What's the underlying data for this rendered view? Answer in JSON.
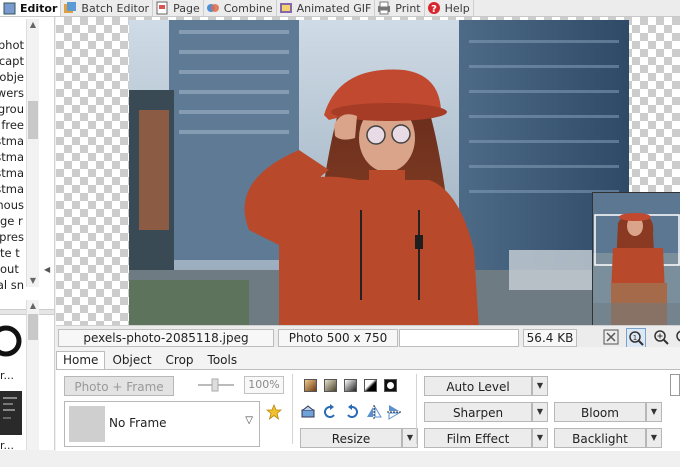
{
  "tabs": [
    {
      "label": "Editor",
      "icon": "editor-icon",
      "active": true
    },
    {
      "label": "Batch Editor",
      "icon": "batch-editor-icon"
    },
    {
      "label": "Page",
      "icon": "page-icon"
    },
    {
      "label": "Combine",
      "icon": "combine-icon"
    },
    {
      "label": "Animated GIF",
      "icon": "animated-gif-icon"
    },
    {
      "label": "Print",
      "icon": "print-icon"
    },
    {
      "label": "Help",
      "icon": "help-icon"
    }
  ],
  "file_list": [
    "phot",
    "capt",
    "obje",
    "wers",
    "kgrou",
    "t free",
    "stma",
    "stma",
    "stma",
    "stma",
    "hous",
    "ge r",
    "pres",
    "te t",
    "out",
    "tal sn"
  ],
  "thumb_labels": [
    "r...",
    "r..."
  ],
  "status": {
    "filename": "pexels-photo-2085118.jpeg",
    "dimensions": "Photo 500 x 750",
    "filesize": "56.4 KB"
  },
  "ribbon": {
    "tabs": [
      "Home",
      "Object",
      "Crop",
      "Tools"
    ],
    "active_tab": "Home",
    "photo_frame_button": "Photo + Frame",
    "zoom_percent": "100%",
    "frame_selected": "No Frame",
    "buttons": {
      "auto_level": "Auto Level",
      "sharpen": "Sharpen",
      "film_effect": "Film Effect",
      "bloom": "Bloom",
      "backlight": "Backlight",
      "resize": "Resize"
    }
  },
  "colors": {
    "tab_active_bg": "#ffffff",
    "canvas_checker": "#cccccc",
    "accent_orange": "#b84a2b"
  }
}
